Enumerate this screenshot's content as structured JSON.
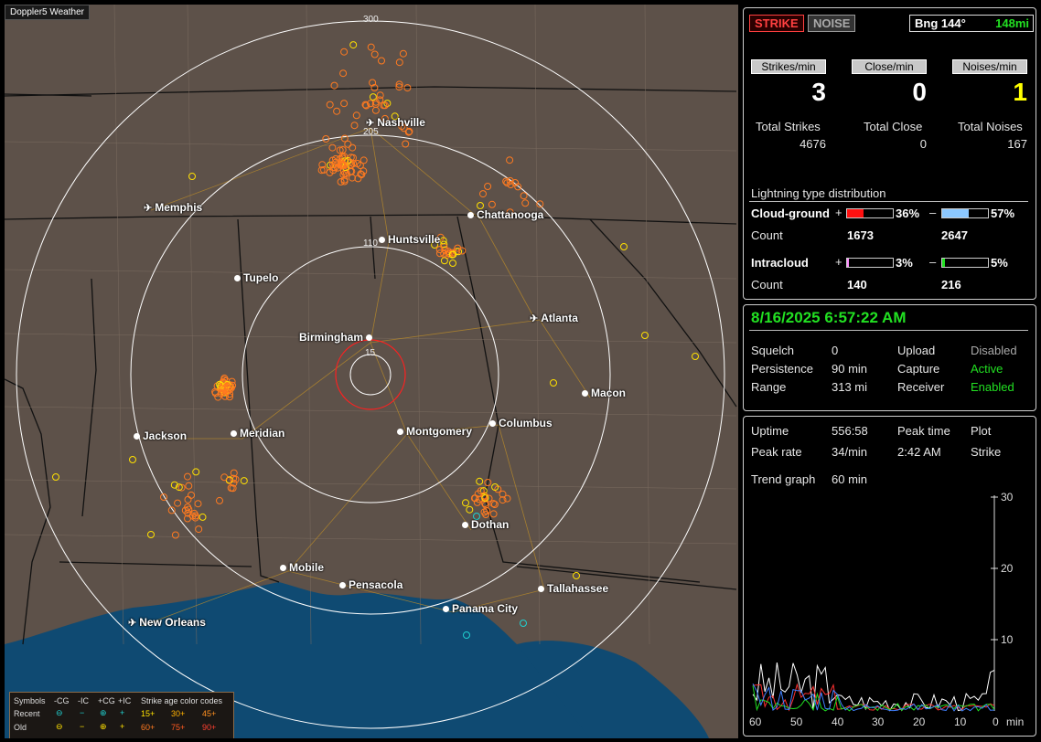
{
  "app": {
    "badge": "Doppler5 Weather"
  },
  "map": {
    "ring_labels": [
      "300",
      "205",
      "110",
      "15"
    ],
    "cities": [
      {
        "name": "Nashville",
        "type": "airport"
      },
      {
        "name": "Memphis",
        "type": "airport"
      },
      {
        "name": "Chattanooga",
        "type": "city"
      },
      {
        "name": "Huntsville",
        "type": "city"
      },
      {
        "name": "Tupelo",
        "type": "city"
      },
      {
        "name": "Atlanta",
        "type": "airport"
      },
      {
        "name": "Birmingham",
        "type": "city"
      },
      {
        "name": "Macon",
        "type": "city"
      },
      {
        "name": "Jackson",
        "type": "city"
      },
      {
        "name": "Meridian",
        "type": "city"
      },
      {
        "name": "Montgomery",
        "type": "city"
      },
      {
        "name": "Columbus",
        "type": "city"
      },
      {
        "name": "Dothan",
        "type": "city"
      },
      {
        "name": "Mobile",
        "type": "city"
      },
      {
        "name": "Pensacola",
        "type": "city"
      },
      {
        "name": "Tallahassee",
        "type": "city"
      },
      {
        "name": "Panama City",
        "type": "city"
      },
      {
        "name": "New Orleans",
        "type": "airport"
      }
    ],
    "legend": {
      "symbols_label": "Symbols",
      "cols": [
        "-CG",
        "-IC",
        "+CG",
        "+IC"
      ],
      "age_title": "Strike age color codes",
      "recent_label": "Recent",
      "old_label": "Old",
      "recent_ages": [
        "15+",
        "30+",
        "45+"
      ],
      "old_ages": [
        "60+",
        "75+",
        "90+"
      ]
    }
  },
  "panel": {
    "strike_btn": "STRIKE",
    "noise_btn": "NOISE",
    "bearing": "Bng 144°",
    "distance": "148mi",
    "rates": {
      "strikes_label": "Strikes/min",
      "strikes_value": "3",
      "close_label": "Close/min",
      "close_value": "0",
      "noises_label": "Noises/min",
      "noises_value": "1"
    },
    "totals": {
      "strikes_label": "Total Strikes",
      "strikes_value": "4676",
      "close_label": "Total Close",
      "close_value": "0",
      "noises_label": "Total Noises",
      "noises_value": "167"
    },
    "dist": {
      "title": "Lightning type distribution",
      "cg_label": "Cloud-ground",
      "cg_pos_pct": "36%",
      "cg_neg_pct": "57%",
      "cg_pos_fill": 0.36,
      "cg_neg_fill": 0.57,
      "count_label": "Count",
      "cg_pos_count": "1673",
      "cg_neg_count": "2647",
      "ic_label": "Intracloud",
      "ic_pos_pct": "3%",
      "ic_neg_pct": "5%",
      "ic_pos_fill": 0.03,
      "ic_neg_fill": 0.05,
      "ic_pos_count": "140",
      "ic_neg_count": "216",
      "plus": "+",
      "minus": "–"
    },
    "status": {
      "datetime": "8/16/2025 6:57:22 AM",
      "squelch_label": "Squelch",
      "squelch_value": "0",
      "upload_label": "Upload",
      "upload_value": "Disabled",
      "persistence_label": "Persistence",
      "persistence_value": "90 min",
      "capture_label": "Capture",
      "capture_value": "Active",
      "range_label": "Range",
      "range_value": "313 mi",
      "receiver_label": "Receiver",
      "receiver_value": "Enabled"
    },
    "stats": {
      "uptime_label": "Uptime",
      "uptime_value": "556:58",
      "peak_time_label": "Peak time",
      "plot_label": "Plot",
      "peak_rate_label": "Peak rate",
      "peak_rate_value": "34/min",
      "peak_time_value": "2:42 AM",
      "plot_value": "Strike",
      "trend_label": "Trend graph",
      "trend_value": "60 min"
    },
    "graph": {
      "y_ticks": [
        "30",
        "20",
        "10"
      ],
      "x_ticks": [
        "60",
        "50",
        "40",
        "30",
        "20",
        "10",
        "0"
      ],
      "x_unit": "min"
    }
  },
  "colors": {
    "ring": "#ffffff",
    "close_ring": "#ff2020",
    "strike_old": "#e07020",
    "strike_recent": "#ffe000",
    "ok": "#22e022",
    "water": "#0f4a72",
    "land": "#5d5149"
  }
}
